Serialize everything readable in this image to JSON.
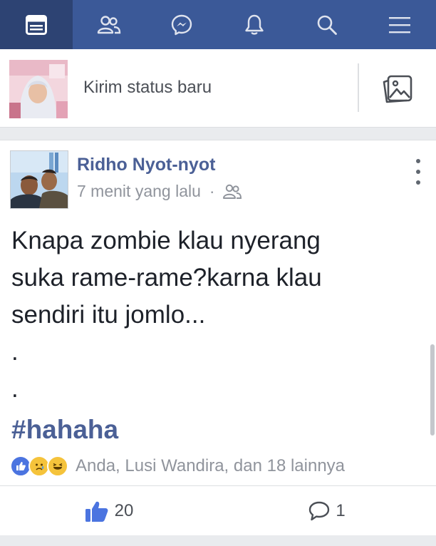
{
  "nav": {
    "tabs": [
      {
        "name": "news-feed",
        "icon": "news-feed-icon",
        "active": true
      },
      {
        "name": "friend-requests",
        "icon": "friends-icon",
        "active": false
      },
      {
        "name": "messages",
        "icon": "messenger-icon",
        "active": false
      },
      {
        "name": "notifications",
        "icon": "bell-icon",
        "active": false
      },
      {
        "name": "search",
        "icon": "search-icon",
        "active": false
      },
      {
        "name": "menu",
        "icon": "menu-icon",
        "active": false
      }
    ],
    "color": "#3b5998",
    "active_color": "#2d4373"
  },
  "composer": {
    "placeholder": "Kirim status baru",
    "photo_icon": "photo-icon"
  },
  "post": {
    "author": "Ridho Nyot-nyot",
    "time": "7 menit yang lalu",
    "separator": "·",
    "audience_icon": "friends-icon",
    "text_lines": [
      "Knapa zombie klau nyerang",
      "suka rame-rame?karna klau",
      "sendiri itu jomlo..."
    ],
    "dots": [
      ".",
      "."
    ],
    "hashtag": "#hahaha",
    "reaction_icons": [
      "like-reaction-icon",
      "sad-reaction-icon",
      "haha-reaction-icon"
    ],
    "reaction_summary": "Anda, Lusi Wandira, dan 18 lainnya",
    "like_count": "20",
    "comment_count": "1",
    "link_color": "#4b6096"
  }
}
